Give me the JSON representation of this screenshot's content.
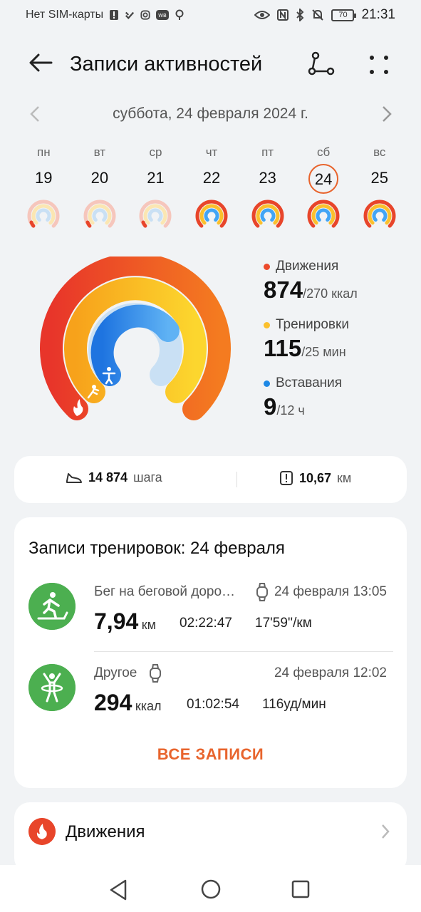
{
  "status": {
    "carrier": "Нет SIM-карты",
    "battery": "70",
    "time": "21:31",
    "icons": [
      "alert-icon",
      "sync-icon",
      "instagram-icon",
      "wb-icon",
      "location-icon",
      "eye-icon",
      "nfc-icon",
      "bluetooth-icon",
      "mute-icon"
    ]
  },
  "header": {
    "title": "Записи активностей"
  },
  "date_nav": {
    "label": "суббота, 24 февраля 2024 г."
  },
  "week": [
    {
      "dow": "пн",
      "num": "19",
      "selected": false
    },
    {
      "dow": "вт",
      "num": "20",
      "selected": false
    },
    {
      "dow": "ср",
      "num": "21",
      "selected": false
    },
    {
      "dow": "чт",
      "num": "22",
      "selected": false
    },
    {
      "dow": "пт",
      "num": "23",
      "selected": false
    },
    {
      "dow": "сб",
      "num": "24",
      "selected": true
    },
    {
      "dow": "вс",
      "num": "25",
      "selected": false
    }
  ],
  "summary": {
    "movement": {
      "label": "Движения",
      "value": "874",
      "goal": "/270 ккал",
      "color": "#ec4a2c"
    },
    "workouts": {
      "label": "Тренировки",
      "value": "115",
      "goal": "/25 мин",
      "color": "#fbc02d"
    },
    "standing": {
      "label": "Вставания",
      "value": "9",
      "goal": "/12 ч",
      "color": "#1e88e5"
    }
  },
  "steps": {
    "count": "14 874",
    "count_unit": "шага",
    "distance": "10,67",
    "distance_unit": "км"
  },
  "workouts_card": {
    "title": "Записи тренировок: 24 февраля",
    "items": [
      {
        "name": "Бег на беговой доро…",
        "date": "24 февраля 13:05",
        "big": "7,94",
        "unit": "км",
        "m2": "02:22:47",
        "m3": "17'59''/км"
      },
      {
        "name": "Другое",
        "date": "24 февраля 12:02",
        "big": "294",
        "unit": "ккал",
        "m2": "01:02:54",
        "m3": "116уд/мин"
      }
    ],
    "all_label": "ВСЕ ЗАПИСИ"
  },
  "movement_card": {
    "title": "Движения"
  },
  "colors": {
    "accent": "#e8642d",
    "green": "#4caf50"
  }
}
